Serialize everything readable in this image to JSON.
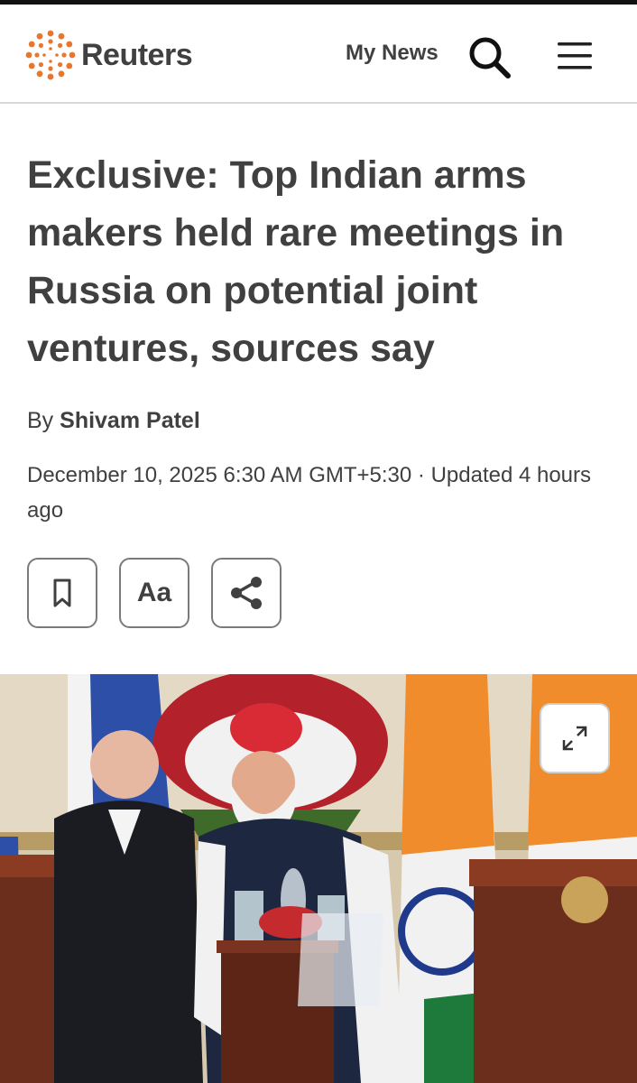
{
  "header": {
    "brand": "Reuters",
    "my_news_label": "My News",
    "icons": {
      "logo": "reuters-dot-ring",
      "search": "search-icon",
      "menu": "hamburger-menu-icon"
    },
    "brand_color": "#e8772e"
  },
  "article": {
    "headline": "Exclusive: Top Indian arms makers held rare meetings in Russia on potential joint ventures, sources say",
    "byline_prefix": "By",
    "author": "Shivam Patel",
    "dateline": "December 10, 2025 6:30 AM GMT+5:30 · Updated 4 hours ago",
    "actions": {
      "bookmark_icon": "bookmark-icon",
      "text_size_label": "Aa",
      "share_icon": "share-icon"
    }
  },
  "photo": {
    "expand_icon": "expand-icon"
  }
}
